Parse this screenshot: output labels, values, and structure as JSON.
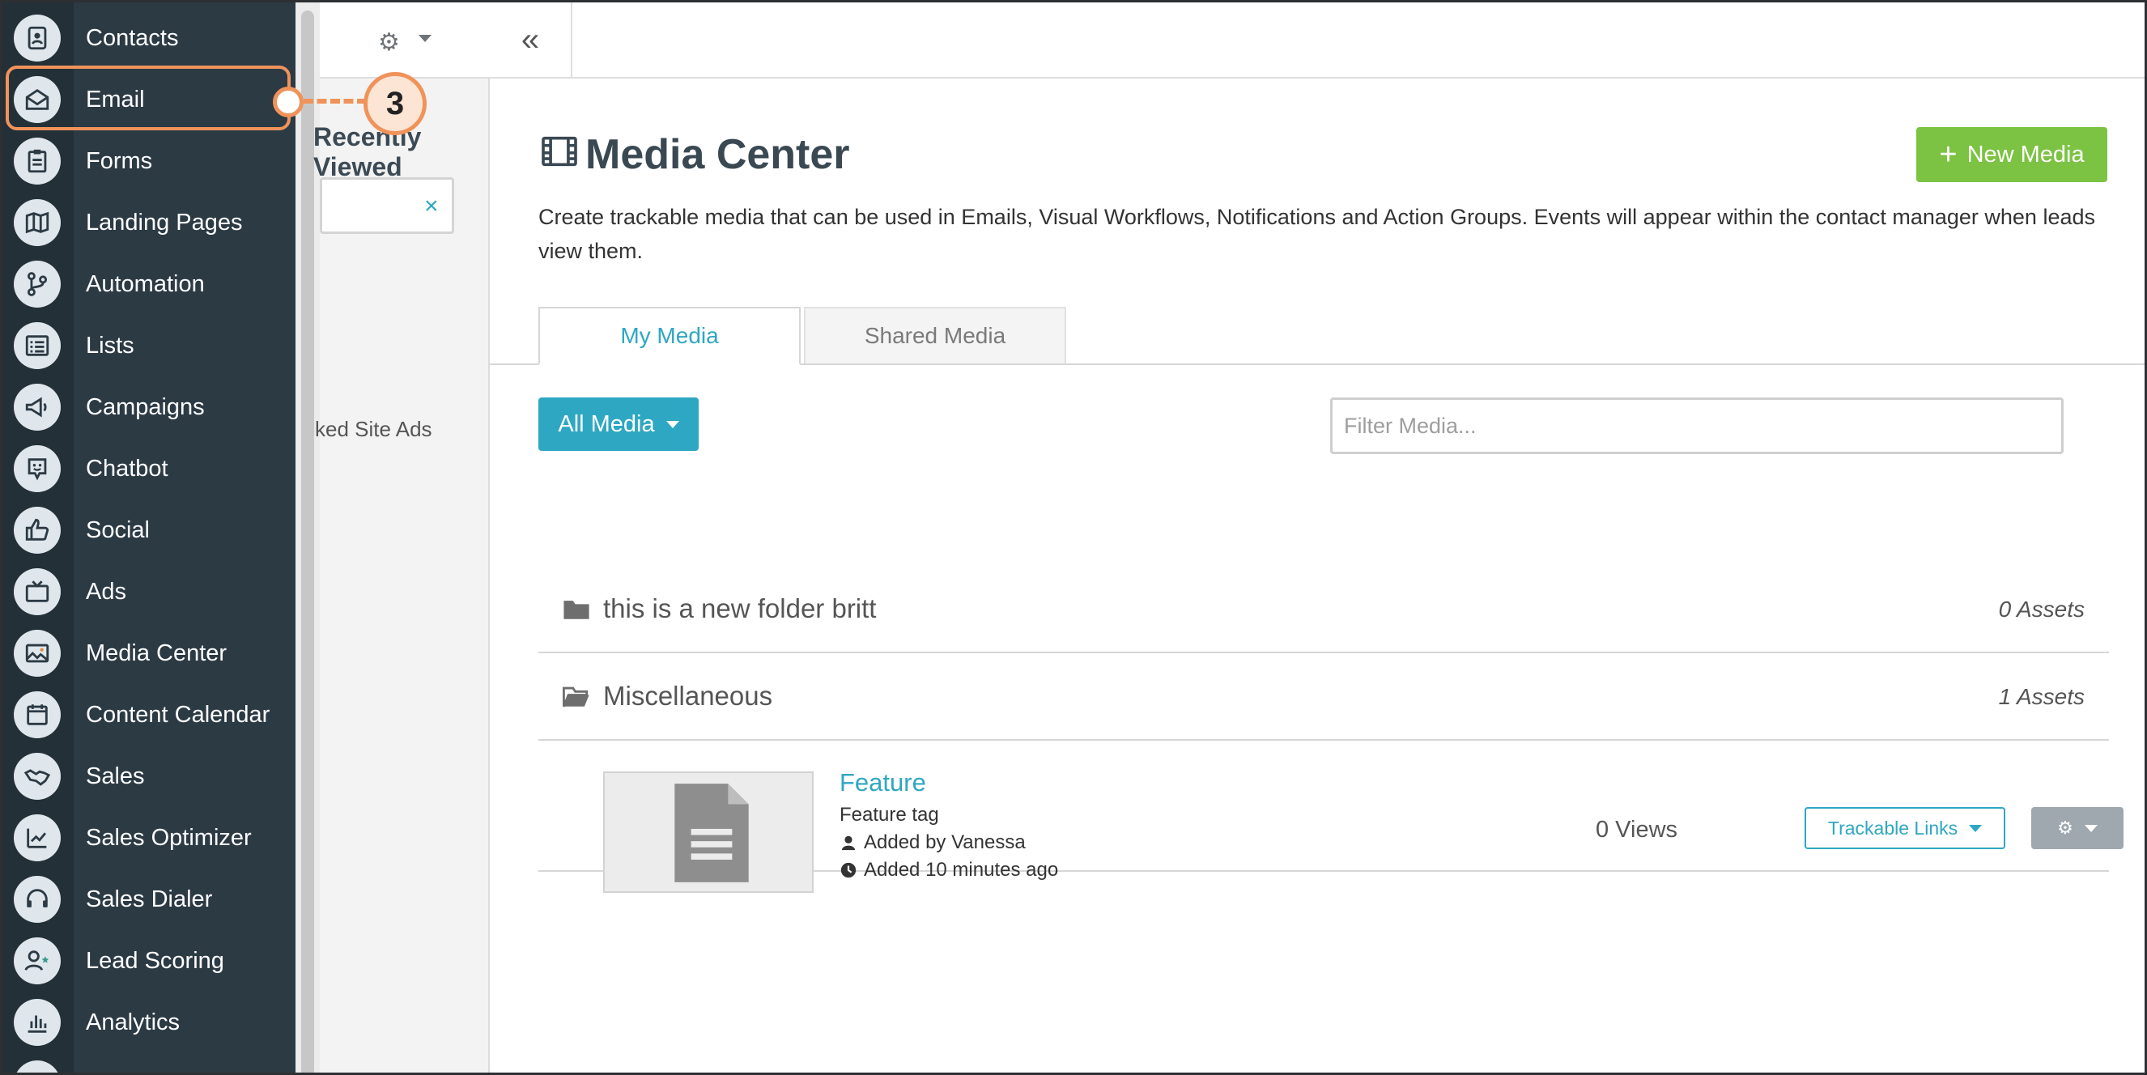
{
  "sidebar": {
    "items": [
      {
        "label": "Contacts",
        "icon": "contacts-icon"
      },
      {
        "label": "Email",
        "icon": "email-icon"
      },
      {
        "label": "Forms",
        "icon": "forms-icon"
      },
      {
        "label": "Landing Pages",
        "icon": "map-icon"
      },
      {
        "label": "Automation",
        "icon": "workflow-icon"
      },
      {
        "label": "Lists",
        "icon": "list-icon"
      },
      {
        "label": "Campaigns",
        "icon": "megaphone-icon"
      },
      {
        "label": "Chatbot",
        "icon": "chatbot-icon"
      },
      {
        "label": "Social",
        "icon": "thumbs-up-icon"
      },
      {
        "label": "Ads",
        "icon": "tv-icon"
      },
      {
        "label": "Media Center",
        "icon": "image-icon"
      },
      {
        "label": "Content Calendar",
        "icon": "calendar-icon"
      },
      {
        "label": "Sales",
        "icon": "handshake-icon"
      },
      {
        "label": "Sales Optimizer",
        "icon": "chart-up-icon"
      },
      {
        "label": "Sales Dialer",
        "icon": "headset-icon"
      },
      {
        "label": "Lead Scoring",
        "icon": "user-star-icon"
      },
      {
        "label": "Analytics",
        "icon": "bar-chart-icon"
      }
    ],
    "callout_number": "3",
    "highlight_color": "#f0935b"
  },
  "midcol": {
    "title": "Recently Viewed",
    "item": "ked Site Ads"
  },
  "main": {
    "title": "Media Center",
    "new_media_label": "New Media",
    "description": "Create trackable media that can be used in Emails, Visual Workflows, Notifications and Action Groups. Events will appear within the contact manager when leads view them.",
    "tabs": [
      {
        "label": "My Media",
        "active": true
      },
      {
        "label": "Shared Media",
        "active": false
      }
    ],
    "all_media_label": "All Media",
    "filter_placeholder": "Filter Media...",
    "folders": [
      {
        "name": "this is a new folder britt",
        "count": "0 Assets",
        "open": false
      },
      {
        "name": "Miscellaneous",
        "count": "1 Assets",
        "open": true
      }
    ],
    "media_item": {
      "name": "Feature",
      "tag": "Feature tag",
      "author": "Added by Vanessa",
      "time": "Added 10 minutes ago",
      "views": "0 Views",
      "trackable_links_label": "Trackable Links"
    }
  },
  "colors": {
    "accent": "#2ea7c2",
    "primary_green": "#7cc243",
    "sidebar_bg": "#2c3a44"
  }
}
